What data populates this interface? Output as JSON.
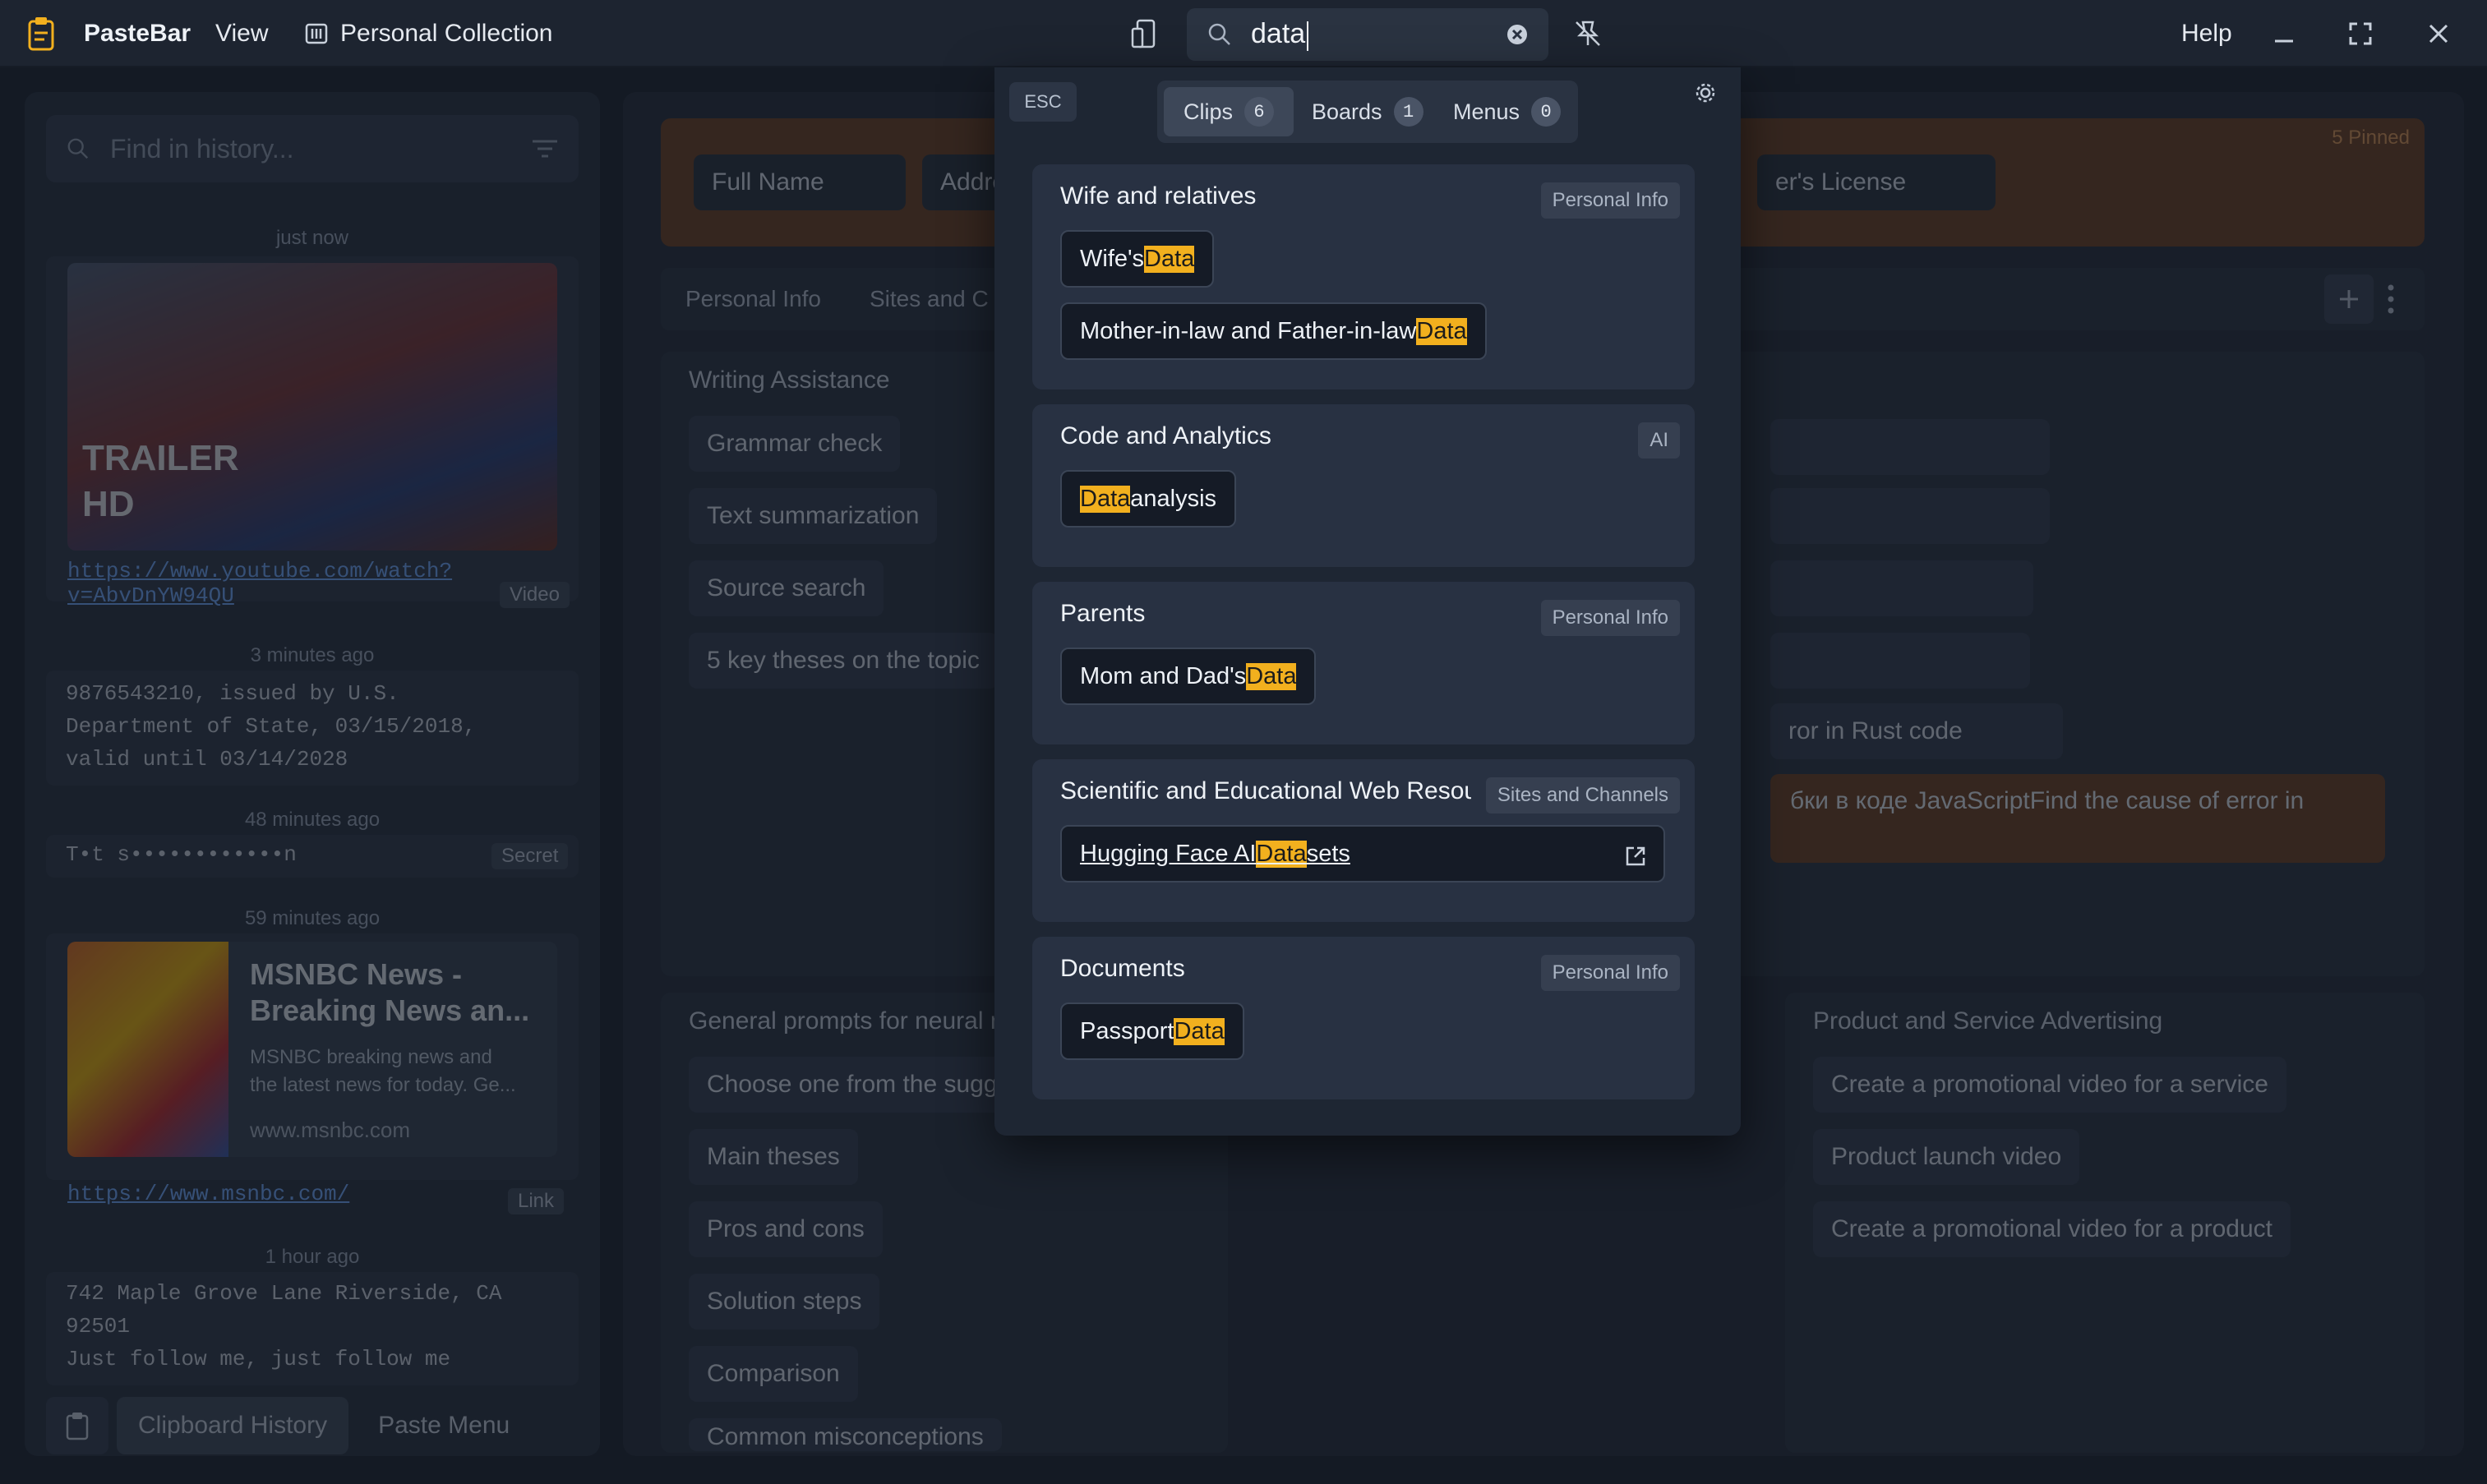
{
  "titlebar": {
    "app_name": "PasteBar",
    "menu_view": "View",
    "collection": "Personal Collection",
    "search_value": "data",
    "help": "Help"
  },
  "history": {
    "search_placeholder": "Find in history...",
    "items": [
      {
        "time": "just now",
        "trailer_text_1": "TRAILER",
        "trailer_text_2": "HD",
        "url_1": "https://www.youtube.com/watch?",
        "url_2": "v=AbvDnYW94QU",
        "tag": "Video"
      },
      {
        "time": "3 minutes ago",
        "line_1": "9876543210, issued by U.S.",
        "line_2": "Department of State, 03/15/2018,",
        "line_3": "valid until 03/14/2028"
      },
      {
        "time": "48 minutes ago",
        "text": "T•t s••••••••••••n",
        "tag": "Secret"
      },
      {
        "time": "59 minutes ago",
        "title_1": "MSNBC News -",
        "title_2": "Breaking News an...",
        "desc_1": "MSNBC breaking news and",
        "desc_2": "the latest news for today. Ge...",
        "site": "www.msnbc.com",
        "url": "https://www.msnbc.com/",
        "tag": "Link"
      },
      {
        "time": "1 hour ago",
        "line_1": "742 Maple Grove Lane Riverside, CA",
        "line_2": "92501",
        "line_3": "Just follow me, just follow me"
      }
    ],
    "tab_history": "Clipboard History",
    "tab_paste": "Paste Menu"
  },
  "main": {
    "pinned": [
      "Full Name",
      "Addre",
      "er's License"
    ],
    "pinned_count": "5 Pinned",
    "tabs": [
      "Personal Info",
      "Sites and C"
    ],
    "writing": {
      "title": "Writing Assistance",
      "items": [
        "Grammar check",
        "Text summarization",
        "Source search",
        "5 key theses on the topic"
      ]
    },
    "rust_item": "ror in Rust code",
    "js_item": "бки в коде JavaScriptFind the cause of error in",
    "general": {
      "title": "General prompts for neural n",
      "items": [
        "Choose one from the sugg",
        "Main theses",
        "Pros and cons",
        "Solution steps",
        "Comparison",
        "Common misconceptions"
      ]
    },
    "product": {
      "title": "Product and Service Advertising",
      "items": [
        "Create a promotional video for a service",
        "Product launch video",
        "Create a promotional video for a product"
      ]
    }
  },
  "popup": {
    "esc": "ESC",
    "tabs": [
      {
        "label": "Clips",
        "count": "6"
      },
      {
        "label": "Boards",
        "count": "1"
      },
      {
        "label": "Menus",
        "count": "0"
      }
    ],
    "groups": [
      {
        "title": "Wife and relatives",
        "tag": "Personal Info",
        "clips": [
          {
            "pre": "Wife's ",
            "hl": "Data",
            "post": ""
          },
          {
            "pre": "Mother-in-law and Father-in-law ",
            "hl": "Data",
            "post": ""
          }
        ]
      },
      {
        "title": "Code and Analytics",
        "tag": "AI",
        "clips": [
          {
            "pre": "",
            "hl": "Data",
            "post": " analysis"
          }
        ]
      },
      {
        "title": "Parents",
        "tag": "Personal Info",
        "clips": [
          {
            "pre": "Mom and Dad's ",
            "hl": "Data",
            "post": ""
          }
        ]
      },
      {
        "title": "Scientific and Educational Web Resou",
        "tag": "Sites and Channels",
        "clips": [
          {
            "pre": "Hugging Face AI ",
            "hl": "Data",
            "post": "sets"
          }
        ]
      },
      {
        "title": "Documents",
        "tag": "Personal Info",
        "clips": [
          {
            "pre": "Passport ",
            "hl": "Data",
            "post": ""
          }
        ]
      }
    ]
  },
  "colors": {
    "accent_highlight": "#f2b01e",
    "pinned_bg": "#6b3a18",
    "popup_bg": "#1e2633"
  }
}
